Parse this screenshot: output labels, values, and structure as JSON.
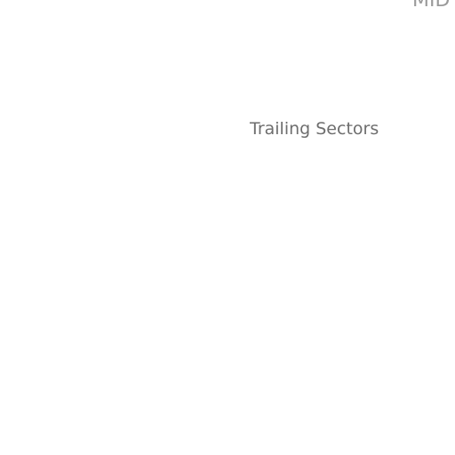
{
  "header": {
    "corner_label": "MID"
  },
  "main": {
    "section_heading": "Trailing Sectors"
  },
  "colors": {
    "background": "#ffffff",
    "corner_label": "#9a9a9a",
    "section_heading": "#6e6e6e"
  }
}
